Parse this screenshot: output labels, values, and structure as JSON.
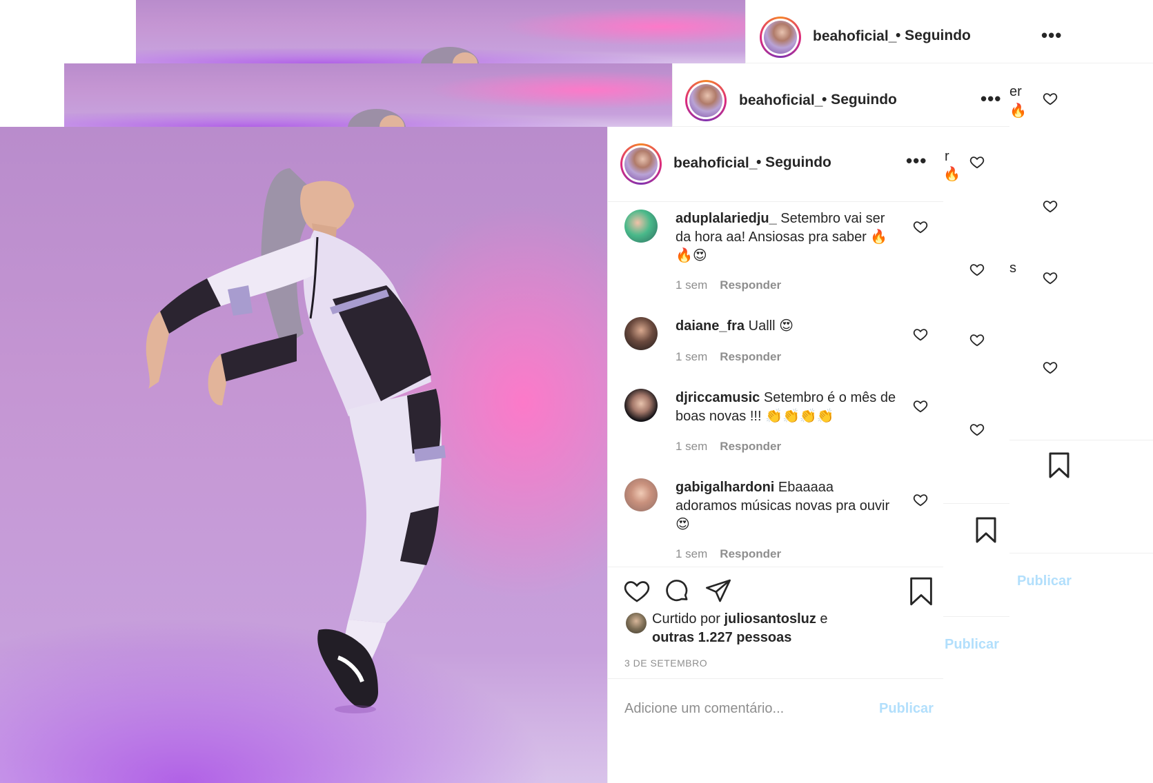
{
  "post": {
    "username": "beahoficial_",
    "follow_status": "• Seguindo",
    "more_icon": "•••"
  },
  "comments": [
    {
      "user": "aduplalariedju_",
      "text": "Setembro vai ser da hora aa! Ansiosas pra saber 🔥🔥😍",
      "time": "1 sem",
      "reply": "Responder"
    },
    {
      "user": "daiane_fra",
      "text": "Ualll 😍",
      "time": "1 sem",
      "reply": "Responder"
    },
    {
      "user": "djriccamusic",
      "text": "Setembro é o mês de boas novas !!! 👏👏👏👏",
      "time": "1 sem",
      "reply": "Responder"
    },
    {
      "user": "gabigalhardoni",
      "text": "Ebaaaaa adoramos músicas novas pra ouvir 😍",
      "time": "1 sem",
      "reply": "Responder"
    }
  ],
  "likes": {
    "prefix": "Curtido por",
    "user": "juliosantosluz",
    "connector": "e",
    "others": "outras 1.227 pessoas"
  },
  "date": "3 DE SETEMBRO",
  "comment_box": {
    "placeholder": "Adicione um comentário...",
    "publish": "Publicar"
  },
  "back_fragments": {
    "text1": "er",
    "text2": "r",
    "text3": "s"
  },
  "colors": {
    "publish_disabled": "#b2dffc",
    "text": "#262626",
    "muted": "#8e8e8e"
  }
}
